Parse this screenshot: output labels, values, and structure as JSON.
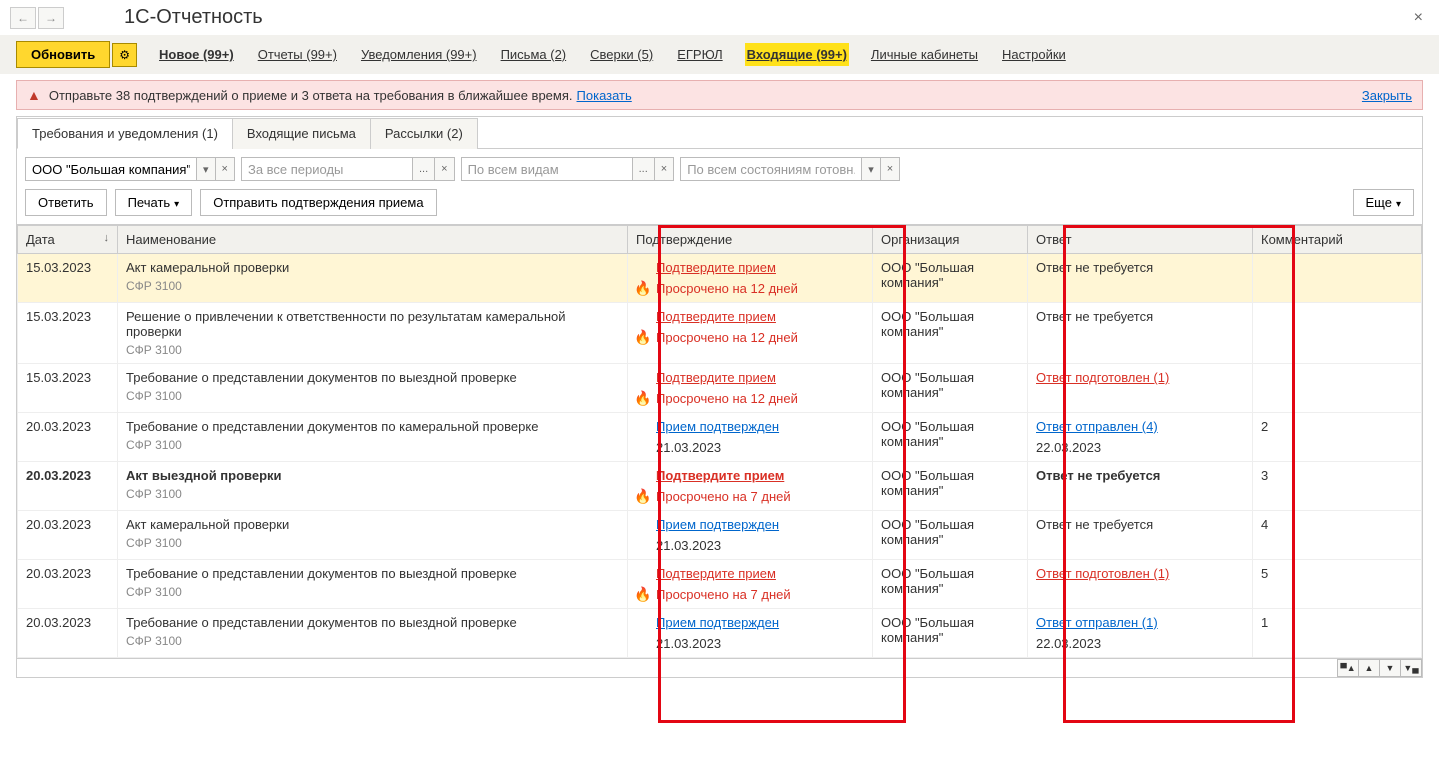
{
  "header": {
    "title": "1С-Отчетность"
  },
  "toolbar": {
    "refresh": "Обновить",
    "new": "Новое (99+)",
    "reports": "Отчеты (99+)",
    "notifications": "Уведомления (99+)",
    "letters": "Письма (2)",
    "reconciliations": "Сверки (5)",
    "egrul": "ЕГРЮЛ",
    "incoming": "Входящие (99+)",
    "cabinets": "Личные кабинеты",
    "settings": "Настройки"
  },
  "warning": {
    "text": "Отправьте 38 подтверждений о приеме и 3 ответа на требования в ближайшее время.",
    "show_link": "Показать",
    "close": "Закрыть"
  },
  "tabs": {
    "t1": "Требования и уведомления (1)",
    "t2": "Входящие письма",
    "t3": "Рассылки (2)"
  },
  "filters": {
    "org_value": "ООО \"Большая компания\"",
    "period_placeholder": "За все периоды",
    "type_placeholder": "По всем видам",
    "state_placeholder": "По всем состояниям готовн..."
  },
  "actions": {
    "reply": "Ответить",
    "print": "Печать",
    "send_confirm": "Отправить подтверждения приема",
    "more": "Еще"
  },
  "columns": {
    "date": "Дата",
    "name": "Наименование",
    "confirmation": "Подтверждение",
    "org": "Организация",
    "answer": "Ответ",
    "comment": "Комментарий"
  },
  "rows": [
    {
      "date": "15.03.2023",
      "name": "Акт камеральной проверки",
      "sub": "СФР 3100",
      "conf_link": "Подтвердите прием",
      "conf_sub": "Просрочено на 12 дней",
      "conf_type": "red_overdue",
      "org": "ООО \"Большая компания\"",
      "answer": "Ответ не требуется",
      "answer_type": "plain",
      "answer_sub": "",
      "comment": "",
      "selected": true,
      "bold": false
    },
    {
      "date": "15.03.2023",
      "name": "Решение о привлечении к ответственности по результатам камеральной проверки",
      "sub": "СФР 3100",
      "conf_link": "Подтвердите прием",
      "conf_sub": "Просрочено на 12 дней",
      "conf_type": "red_overdue",
      "org": "ООО \"Большая компания\"",
      "answer": "Ответ не требуется",
      "answer_type": "plain",
      "answer_sub": "",
      "comment": "",
      "selected": false,
      "bold": false
    },
    {
      "date": "15.03.2023",
      "name": "Требование о представлении документов по выездной проверке",
      "sub": "СФР 3100",
      "conf_link": "Подтвердите прием",
      "conf_sub": "Просрочено на 12 дней",
      "conf_type": "red_overdue",
      "org": "ООО \"Большая компания\"",
      "answer": "Ответ подготовлен (1)",
      "answer_type": "red_link",
      "answer_sub": "",
      "comment": "",
      "selected": false,
      "bold": false
    },
    {
      "date": "20.03.2023",
      "name": "Требование о представлении документов по камеральной проверке",
      "sub": "СФР 3100",
      "conf_link": "Прием подтвержден",
      "conf_sub": "21.03.2023",
      "conf_type": "blue_done",
      "org": "ООО \"Большая компания\"",
      "answer": "Ответ отправлен (4)",
      "answer_type": "blue_link",
      "answer_sub": "22.03.2023",
      "comment": "2",
      "selected": false,
      "bold": false
    },
    {
      "date": "20.03.2023",
      "name": "Акт выездной проверки",
      "sub": "СФР 3100",
      "conf_link": "Подтвердите прием",
      "conf_sub": "Просрочено на 7 дней",
      "conf_type": "red_overdue",
      "org": "ООО \"Большая компания\"",
      "answer": "Ответ не требуется",
      "answer_type": "plain_bold",
      "answer_sub": "",
      "comment": "3",
      "selected": false,
      "bold": true
    },
    {
      "date": "20.03.2023",
      "name": "Акт камеральной проверки",
      "sub": "СФР 3100",
      "conf_link": "Прием подтвержден",
      "conf_sub": "21.03.2023",
      "conf_type": "blue_done",
      "org": "ООО \"Большая компания\"",
      "answer": "Ответ не требуется",
      "answer_type": "plain",
      "answer_sub": "",
      "comment": "4",
      "selected": false,
      "bold": false
    },
    {
      "date": "20.03.2023",
      "name": "Требование о представлении документов по выездной проверке",
      "sub": "СФР 3100",
      "conf_link": "Подтвердите прием",
      "conf_sub": "Просрочено на 7 дней",
      "conf_type": "red_overdue",
      "org": "ООО \"Большая компания\"",
      "answer": "Ответ подготовлен (1)",
      "answer_type": "red_link",
      "answer_sub": "",
      "comment": "5",
      "selected": false,
      "bold": false
    },
    {
      "date": "20.03.2023",
      "name": "Требование о представлении документов по выездной проверке",
      "sub": "СФР 3100",
      "conf_link": "Прием подтвержден",
      "conf_sub": "21.03.2023",
      "conf_type": "blue_done",
      "org": "ООО \"Большая компания\"",
      "answer": "Ответ отправлен (1)",
      "answer_type": "blue_link",
      "answer_sub": "22.03.2023",
      "comment": "1",
      "selected": false,
      "bold": false
    }
  ]
}
